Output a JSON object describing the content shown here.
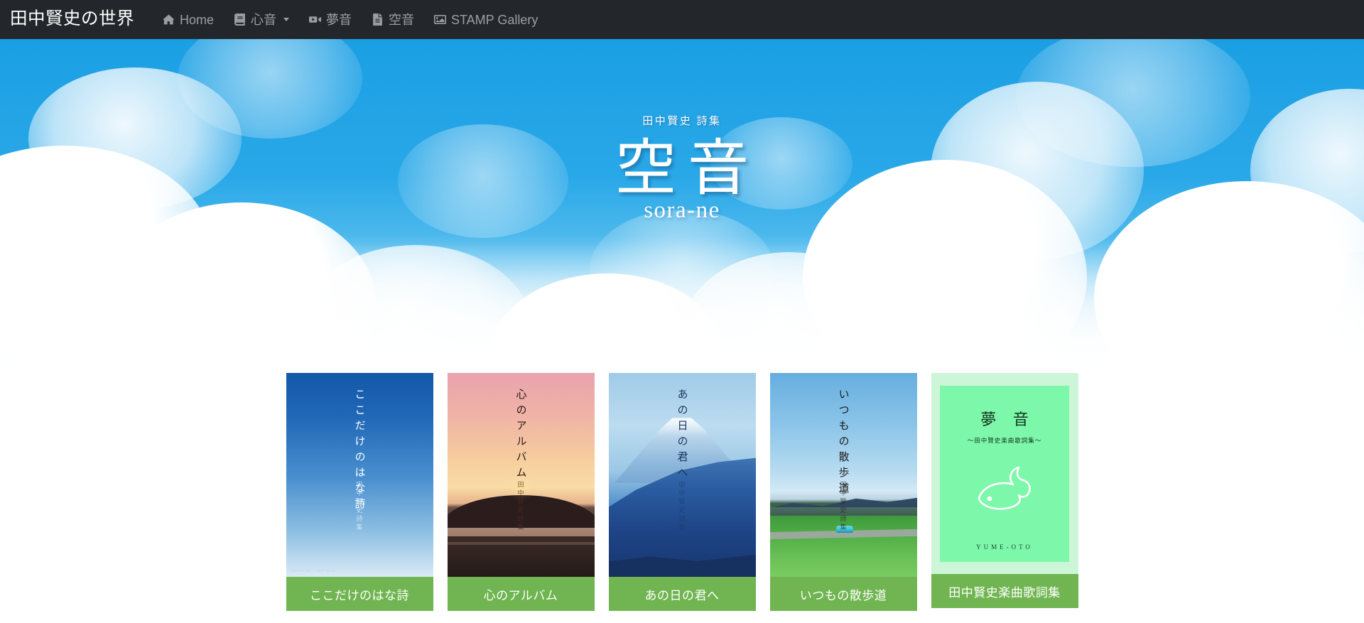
{
  "navbar": {
    "brand": "田中賢史の世界",
    "background": "#23272b",
    "items": [
      {
        "label": "Home",
        "icon": "home-icon",
        "caret": false
      },
      {
        "label": "心音",
        "icon": "book-icon",
        "caret": true
      },
      {
        "label": "夢音",
        "icon": "video-icon",
        "caret": false
      },
      {
        "label": "空音",
        "icon": "file-icon",
        "caret": false
      },
      {
        "label": "STAMP Gallery",
        "icon": "image-icon",
        "caret": false
      }
    ]
  },
  "hero": {
    "kicker": "田中賢史 詩集",
    "title": "空音",
    "subtitle": "sora-ne",
    "sky_color": "#1fa4e6"
  },
  "cards": {
    "accent": "#70b551",
    "items": [
      {
        "label": "ここだけのはな詩",
        "cover_title": "ここだけのはな詩",
        "cover_author": "田中賢史詩集",
        "cover_footer": "1979.04.20 — 1997.12.31"
      },
      {
        "label": "心のアルバム",
        "cover_title": "心のアルバム",
        "cover_author": "田中賢史詩集",
        "cover_footer": ""
      },
      {
        "label": "あの日の君へ",
        "cover_title": "あの日の君へ",
        "cover_author": "田中賢史詩集",
        "cover_footer": ""
      },
      {
        "label": "いつもの散歩道",
        "cover_title": "いつもの散歩道",
        "cover_author": "田中賢史詩集",
        "cover_footer": ""
      }
    ],
    "music": {
      "label": "田中賢史楽曲歌詞集",
      "cover_title": "夢 音",
      "cover_subtitle": "〜田中賢史楽曲歌詞集〜",
      "cover_romaji": "YUME-OTO",
      "inner_color": "#7df7a9",
      "outer_color": "#cdf6d9"
    }
  }
}
